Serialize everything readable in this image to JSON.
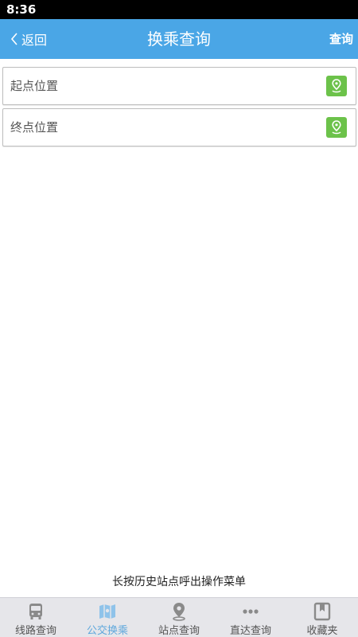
{
  "status_bar": {
    "time": "8:36"
  },
  "header": {
    "back_label": "返回",
    "title": "换乘查询",
    "query_label": "查询"
  },
  "form": {
    "start_placeholder": "起点位置",
    "end_placeholder": "终点位置"
  },
  "hint": "长按历史站点呼出操作菜单",
  "tabs": [
    {
      "label": "线路查询",
      "icon": "bus-icon",
      "active": false
    },
    {
      "label": "公交换乘",
      "icon": "map-icon",
      "active": true
    },
    {
      "label": "站点查询",
      "icon": "location-pin-icon",
      "active": false
    },
    {
      "label": "直达查询",
      "icon": "more-dots-icon",
      "active": false
    },
    {
      "label": "收藏夹",
      "icon": "bookmark-icon",
      "active": false
    }
  ],
  "colors": {
    "app_bar": "#4aa6e6",
    "pin_button": "#6cc24a",
    "tab_active": "#5fa8dc",
    "tab_inactive": "#888888"
  }
}
